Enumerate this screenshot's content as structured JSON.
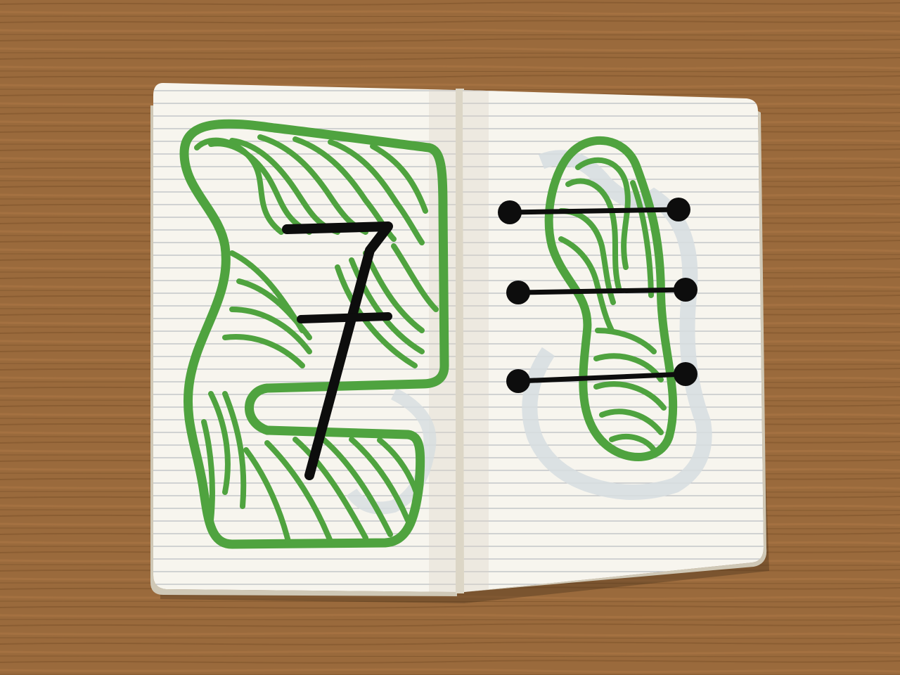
{
  "scene": {
    "subject": "open-lined-notebook-with-marker-drawings",
    "left_page_glyph": "7",
    "colors": {
      "table_wood": "#9a6a3c",
      "table_wood_dark": "#6e4722",
      "page_paper": "#f7f5ee",
      "page_shadow": "#d9d4c6",
      "rule_line": "#b9bcc2",
      "green_marker": "#4fa33f",
      "black_marker": "#0d0d0d",
      "show_through_ghost": "#d6dde0"
    },
    "right_page_dumbbell_count": 3
  }
}
